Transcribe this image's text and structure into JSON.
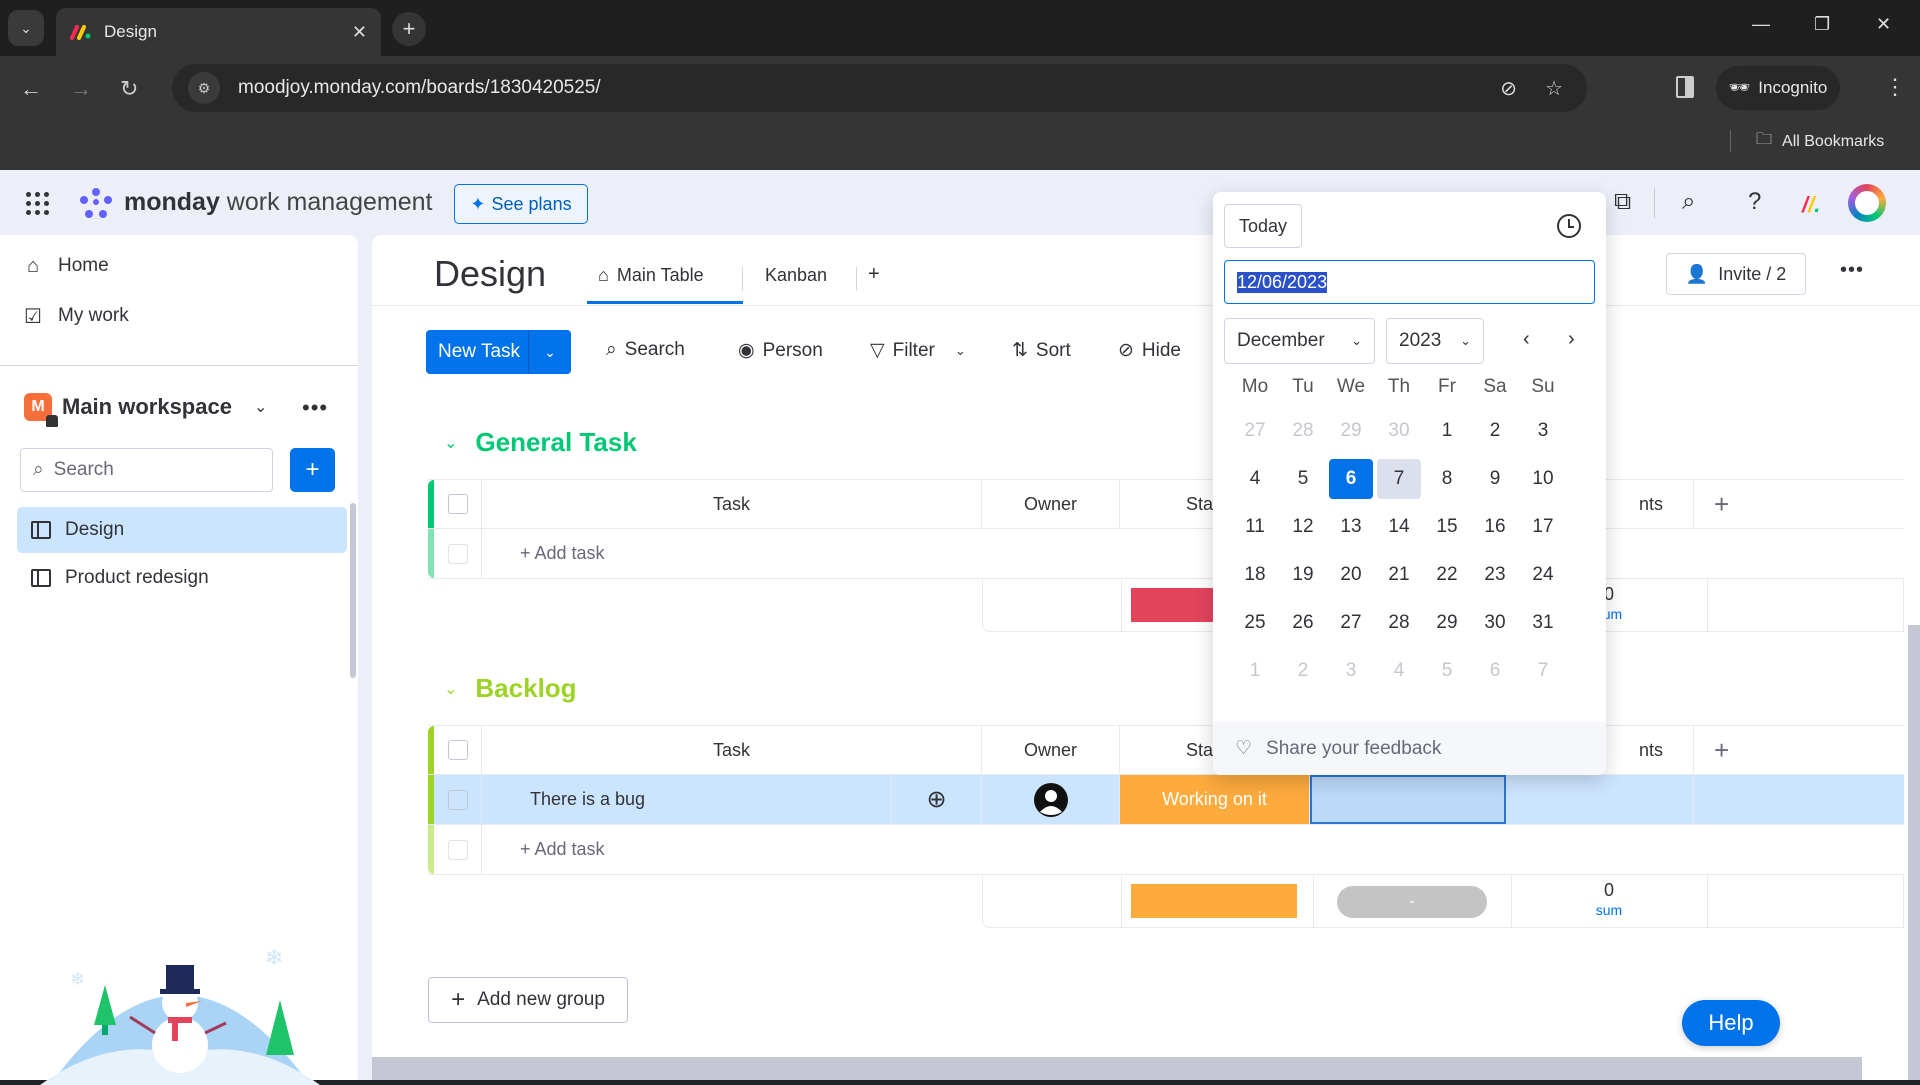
{
  "browser": {
    "tab_title": "Design",
    "url": "moodjoy.monday.com/boards/1830420525/",
    "incognito_label": "Incognito",
    "bookmarks_label": "All Bookmarks",
    "icons": [
      "tab-search-icon",
      "close-icon",
      "new-tab-icon",
      "minimize-icon",
      "restore-icon",
      "window-close-icon",
      "back-icon",
      "forward-icon",
      "reload-icon",
      "site-settings-icon",
      "eye-off-icon",
      "star-icon",
      "side-panel-icon",
      "incognito-icon",
      "kebab-menu-icon",
      "folder-icon"
    ]
  },
  "topbar": {
    "brand_bold": "monday",
    "brand_light": " work management",
    "see_plans": "See plans",
    "icons": [
      "apps-grid-icon",
      "puzzle-icon",
      "search-icon",
      "help-icon",
      "monday-logo-icon",
      "avatar-icon"
    ]
  },
  "sidebar": {
    "nav": [
      {
        "label": "Home",
        "icon": "home-icon"
      },
      {
        "label": "My work",
        "icon": "calendar-check-icon"
      }
    ],
    "workspace": {
      "initial": "M",
      "name": "Main workspace"
    },
    "search_placeholder": "Search",
    "add_label": "+",
    "boards": [
      {
        "label": "Design",
        "active": true
      },
      {
        "label": "Product redesign",
        "active": false
      }
    ]
  },
  "board": {
    "title": "Design",
    "views": [
      {
        "label": "Main Table",
        "active": true
      },
      {
        "label": "Kanban",
        "active": false
      }
    ],
    "add_view": "+",
    "invite_label": "Invite / 2",
    "toolbar": {
      "new_task": "New Task",
      "search": "Search",
      "person": "Person",
      "filter": "Filter",
      "sort": "Sort",
      "hide": "Hide"
    },
    "groups": [
      {
        "title": "General Task",
        "color": "#00c875",
        "columns": [
          "Task",
          "Owner",
          "Sta",
          "nts"
        ],
        "rows": [],
        "add_task": "+ Add task",
        "summary": {
          "status_color": "#e2445c",
          "sum_value": "0",
          "sum_label": "sum"
        }
      },
      {
        "title": "Backlog",
        "color": "#9cd326",
        "columns": [
          "Task",
          "Owner",
          "Sta",
          "nts"
        ],
        "rows": [
          {
            "task": "There is a bug",
            "owner": "avatar-icon",
            "status": "Working on it",
            "status_color": "#fdab3d",
            "date": ""
          }
        ],
        "add_task": "+ Add task",
        "summary": {
          "status_color": "#fdab3d",
          "date_pill": "-",
          "sum_value": "0",
          "sum_label": "sum"
        }
      }
    ],
    "add_group": "Add new group",
    "help": "Help"
  },
  "datepicker": {
    "today_label": "Today",
    "input_value": "12/06/2023",
    "month": "December",
    "year": "2023",
    "prev": "‹",
    "next": "›",
    "weekdays": [
      "Mo",
      "Tu",
      "We",
      "Th",
      "Fr",
      "Sa",
      "Su"
    ],
    "weeks": [
      [
        {
          "d": "27",
          "m": true
        },
        {
          "d": "28",
          "m": true
        },
        {
          "d": "29",
          "m": true
        },
        {
          "d": "30",
          "m": true
        },
        {
          "d": "1"
        },
        {
          "d": "2"
        },
        {
          "d": "3"
        }
      ],
      [
        {
          "d": "4"
        },
        {
          "d": "5"
        },
        {
          "d": "6",
          "sel": true
        },
        {
          "d": "7",
          "hover": true
        },
        {
          "d": "8"
        },
        {
          "d": "9"
        },
        {
          "d": "10"
        }
      ],
      [
        {
          "d": "11"
        },
        {
          "d": "12"
        },
        {
          "d": "13"
        },
        {
          "d": "14"
        },
        {
          "d": "15"
        },
        {
          "d": "16"
        },
        {
          "d": "17"
        }
      ],
      [
        {
          "d": "18"
        },
        {
          "d": "19"
        },
        {
          "d": "20"
        },
        {
          "d": "21"
        },
        {
          "d": "22"
        },
        {
          "d": "23"
        },
        {
          "d": "24"
        }
      ],
      [
        {
          "d": "25"
        },
        {
          "d": "26"
        },
        {
          "d": "27"
        },
        {
          "d": "28"
        },
        {
          "d": "29"
        },
        {
          "d": "30"
        },
        {
          "d": "31"
        }
      ],
      [
        {
          "d": "1",
          "m": true
        },
        {
          "d": "2",
          "m": true
        },
        {
          "d": "3",
          "m": true
        },
        {
          "d": "4",
          "m": true
        },
        {
          "d": "5",
          "m": true
        },
        {
          "d": "6",
          "m": true
        },
        {
          "d": "7",
          "m": true
        }
      ]
    ],
    "feedback": "Share your feedback"
  }
}
